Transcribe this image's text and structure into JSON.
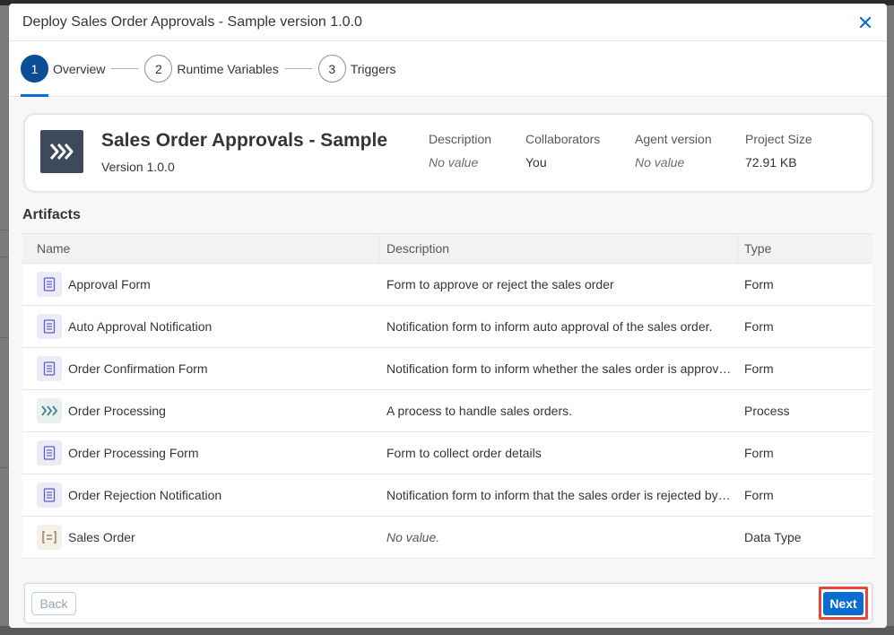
{
  "dialog": {
    "title": "Deploy Sales Order Approvals - Sample version 1.0.0"
  },
  "wizard": {
    "steps": [
      {
        "number": "1",
        "label": "Overview",
        "active": true
      },
      {
        "number": "2",
        "label": "Runtime Variables",
        "active": false
      },
      {
        "number": "3",
        "label": "Triggers",
        "active": false
      }
    ]
  },
  "project": {
    "name": "Sales Order Approvals - Sample",
    "version": "Version 1.0.0",
    "meta": [
      {
        "label": "Description",
        "value": "No value",
        "empty": true
      },
      {
        "label": "Collaborators",
        "value": "You",
        "empty": false
      },
      {
        "label": "Agent version",
        "value": "No value",
        "empty": true
      },
      {
        "label": "Project Size",
        "value": "72.91 KB",
        "empty": false
      }
    ]
  },
  "artifacts": {
    "title": "Artifacts",
    "columns": [
      "Name",
      "Description",
      "Type"
    ],
    "rows": [
      {
        "icon": "form-icon",
        "name": "Approval Form",
        "description": "Form to approve or reject the sales order",
        "type": "Form"
      },
      {
        "icon": "form-icon",
        "name": "Auto Approval Notification",
        "description": "Notification form to inform auto approval of the sales order.",
        "type": "Form"
      },
      {
        "icon": "form-icon",
        "name": "Order Confirmation Form",
        "description": "Notification form to inform whether the sales order is approv…",
        "type": "Form"
      },
      {
        "icon": "process-icon",
        "name": "Order Processing",
        "description": "A process to handle sales orders.",
        "type": "Process"
      },
      {
        "icon": "form-icon",
        "name": "Order Processing Form",
        "description": "Form to collect order details",
        "type": "Form"
      },
      {
        "icon": "form-icon",
        "name": "Order Rejection Notification",
        "description": "Notification form to inform that the sales order is rejected by…",
        "type": "Form"
      },
      {
        "icon": "data-type-icon",
        "name": "Sales Order",
        "description": "No value.",
        "type": "Data Type",
        "empty_description": true
      }
    ]
  },
  "footer": {
    "back_label": "Back",
    "next_label": "Next"
  },
  "colors": {
    "accent": "#0a6ed1",
    "active_step": "#0a4e96",
    "highlight": "#e8453c",
    "project_icon_bg": "#3d4a5a"
  }
}
